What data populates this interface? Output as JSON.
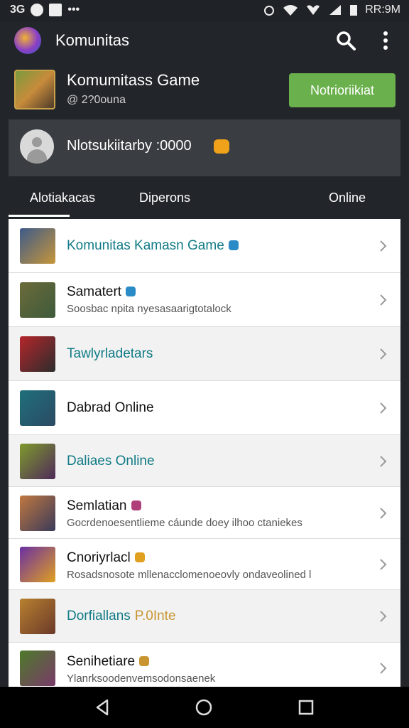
{
  "status_bar": {
    "left_text": "3G",
    "time": "RR:9M"
  },
  "app_bar": {
    "title": "Komunitas"
  },
  "header": {
    "game_title": "Komumitass Game",
    "member_count": "@ 2?0ouna",
    "notify_button": "Notrioriikiat"
  },
  "user": {
    "text": "Nlotsukiitarby :0000"
  },
  "tabs": [
    "Alotiakacas",
    "Diperons",
    "Online"
  ],
  "list": [
    {
      "title": "Komunitas Kamasn Game",
      "subtitle": "",
      "title_color": "teal",
      "badge_color": "#2a8bc6",
      "thumb_colors": [
        "#3d5a8a",
        "#c7963a"
      ],
      "alt": false
    },
    {
      "title": "Samatert",
      "subtitle": "Soosbac npita nyesasaarigtotalock",
      "title_color": "dark",
      "badge_color": "#2a8bc6",
      "thumb_colors": [
        "#6b6b3a",
        "#3e5a3b"
      ],
      "alt": false
    },
    {
      "title": "Tawlyrladetars",
      "subtitle": "",
      "title_color": "teal",
      "badge_color": "",
      "thumb_colors": [
        "#b5262b",
        "#2c2c2c"
      ],
      "alt": true
    },
    {
      "title": "Dabrad Online",
      "subtitle": "",
      "title_color": "dark",
      "badge_color": "",
      "thumb_colors": [
        "#1f6f7a",
        "#2b4a64"
      ],
      "alt": false
    },
    {
      "title": "Daliaes Online",
      "subtitle": "",
      "title_color": "teal",
      "badge_color": "",
      "thumb_colors": [
        "#7e9a2c",
        "#4f2a5a"
      ],
      "alt": true
    },
    {
      "title": "Semlatian",
      "subtitle": "Gocrdenoesentlieme cáunde doey ilhoo ctaniekes",
      "title_color": "dark",
      "badge_color": "#b0407a",
      "thumb_colors": [
        "#c07840",
        "#3a3a5a"
      ],
      "alt": false
    },
    {
      "title": "Cnoriyrlacl",
      "subtitle": "Rosadsnosote mllenacclomenoeovly ondaveolined l",
      "title_color": "dark",
      "badge_color": "#e0a020",
      "thumb_colors": [
        "#6a2fa3",
        "#e0a020"
      ],
      "alt": false
    },
    {
      "title": "Dorfiallans",
      "subtitle": "",
      "title_color": "teal",
      "badge_color": "",
      "title_extra": "P.0Inte",
      "thumb_colors": [
        "#b8802f",
        "#6b3a2a"
      ],
      "alt": true
    },
    {
      "title": "Senihetiare",
      "subtitle": "Ylanrksoodenvemsodonsaenek",
      "title_color": "dark",
      "badge_color": "#c89530",
      "thumb_colors": [
        "#4d7a2a",
        "#7a3a6a"
      ],
      "alt": false
    }
  ]
}
